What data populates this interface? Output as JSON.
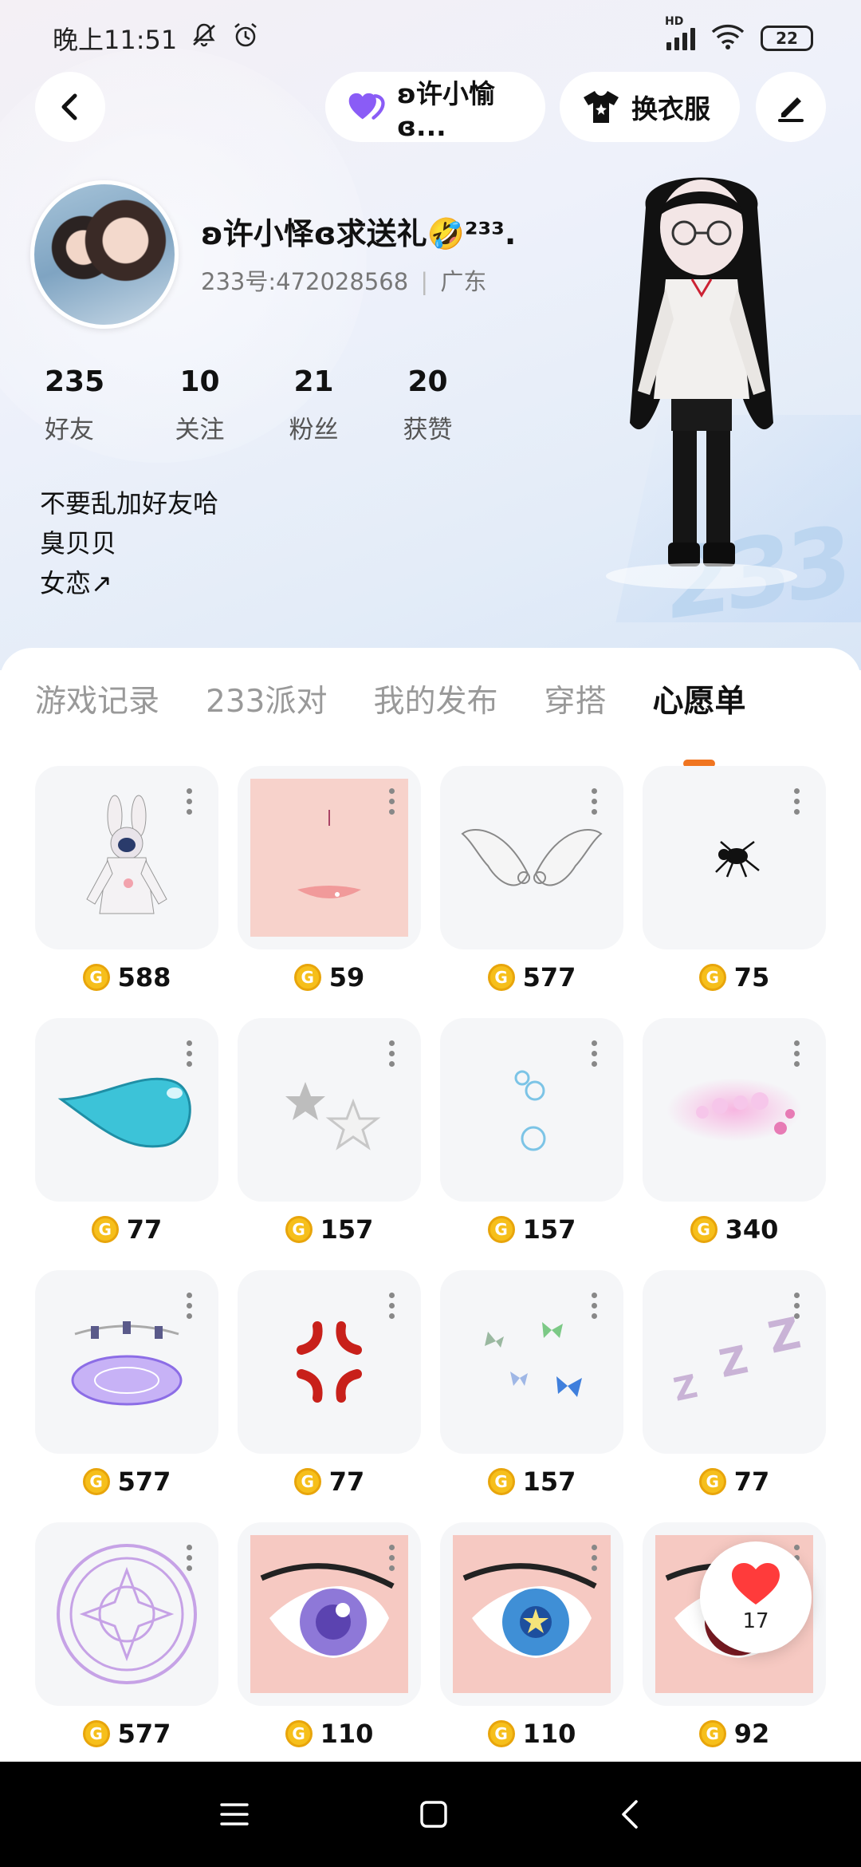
{
  "status_bar": {
    "time": "晚上11:51",
    "battery": "22",
    "network": "HD"
  },
  "top_nav": {
    "friend_label": "ʚ许小愉ɞ...",
    "dress_label": "换衣服"
  },
  "profile": {
    "username": "ʚ许小怿ɞ求送礼🤣²³³.",
    "user_id": "233号:472028568",
    "location": "广东",
    "stats": [
      {
        "num": "235",
        "label": "好友"
      },
      {
        "num": "10",
        "label": "关注"
      },
      {
        "num": "21",
        "label": "粉丝"
      },
      {
        "num": "20",
        "label": "获赞"
      }
    ],
    "bio": [
      "不要乱加好友哈",
      "臭贝贝",
      "女恋↗"
    ]
  },
  "tabs": [
    "游戏记录",
    "233派对",
    "我的发布",
    "穿搭",
    "心愿单"
  ],
  "active_tab": "心愿单",
  "wishlist": [
    {
      "price": "588",
      "icon": "bunny-hoodie-icon"
    },
    {
      "price": "59",
      "icon": "lips-icon"
    },
    {
      "price": "577",
      "icon": "angel-wings-icon"
    },
    {
      "price": "75",
      "icon": "spider-icon"
    },
    {
      "price": "77",
      "icon": "water-drop-icon"
    },
    {
      "price": "157",
      "icon": "stars-icon"
    },
    {
      "price": "157",
      "icon": "bubbles-icon"
    },
    {
      "price": "340",
      "icon": "sparkle-flowers-icon"
    },
    {
      "price": "577",
      "icon": "magic-platform-icon"
    },
    {
      "price": "77",
      "icon": "anger-mark-icon"
    },
    {
      "price": "157",
      "icon": "butterflies-icon"
    },
    {
      "price": "77",
      "icon": "zzz-icon"
    },
    {
      "price": "577",
      "icon": "magic-circle-icon"
    },
    {
      "price": "110",
      "icon": "purple-eye-icon"
    },
    {
      "price": "110",
      "icon": "blue-eye-icon"
    },
    {
      "price": "92",
      "icon": "red-eye-icon"
    }
  ],
  "like_count": "17",
  "colors": {
    "accent": "#f07520",
    "coin": "#f6bf1b",
    "heart": "#ff3b3b",
    "friend_heart": "#8a5cf6"
  }
}
